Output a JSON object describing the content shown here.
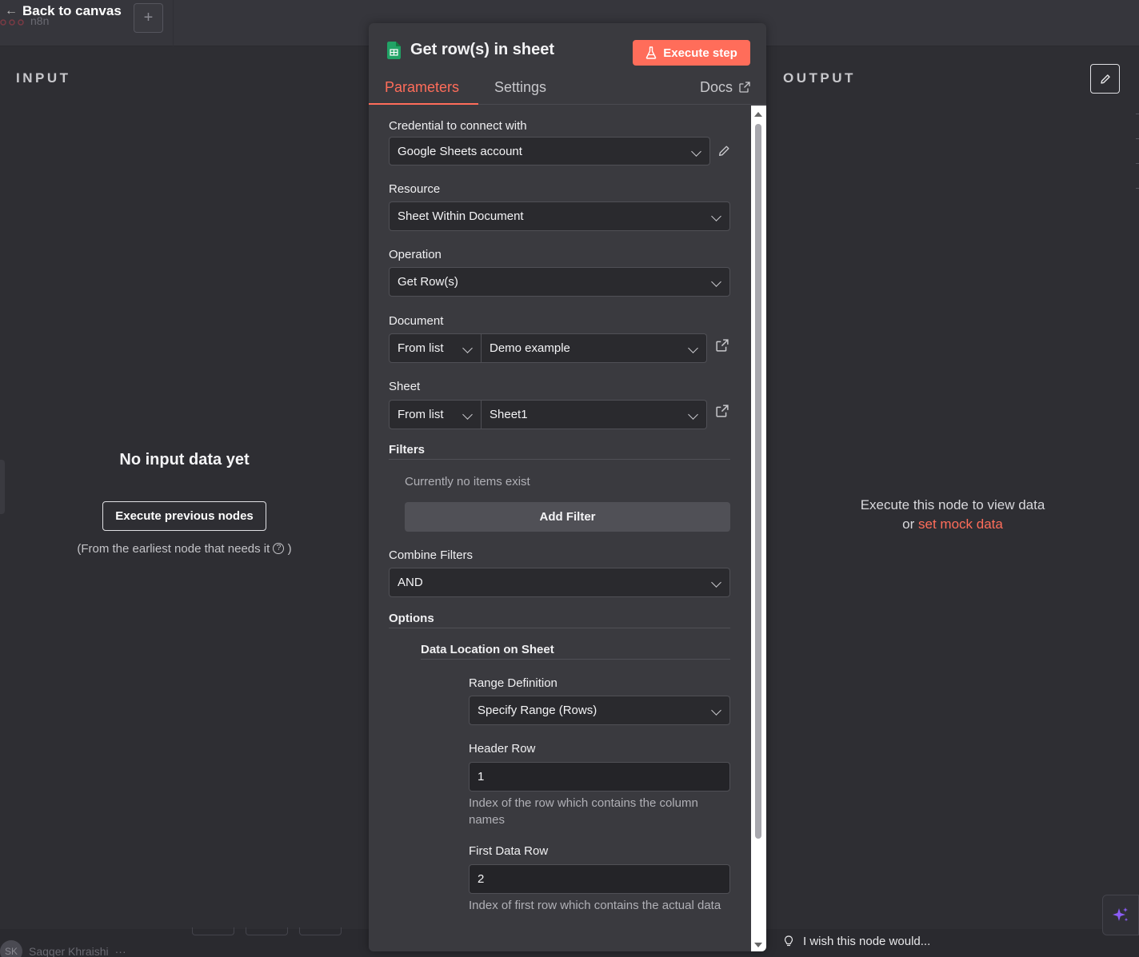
{
  "topbar": {
    "back_label": "Back to canvas",
    "ghost_text": "n8n",
    "plus_label": "+"
  },
  "input_panel": {
    "title": "INPUT",
    "empty_headline": "No input data yet",
    "execute_prev_label": "Execute previous nodes",
    "hint_prefix": "(From the earliest node that needs it",
    "hint_suffix": ")",
    "help_glyph": "?"
  },
  "output_panel": {
    "title": "OUTPUT",
    "empty_line1": "Execute this node to view data",
    "empty_or": "or",
    "mock_link": "set mock data"
  },
  "node": {
    "title": "Get row(s) in sheet",
    "execute_step_label": "Execute step",
    "tabs": {
      "parameters": "Parameters",
      "settings": "Settings",
      "docs": "Docs"
    },
    "fields": {
      "credential_label": "Credential to connect with",
      "credential_value": "Google Sheets account",
      "resource_label": "Resource",
      "resource_value": "Sheet Within Document",
      "operation_label": "Operation",
      "operation_value": "Get Row(s)",
      "document_label": "Document",
      "document_mode": "From list",
      "document_value": "Demo example",
      "sheet_label": "Sheet",
      "sheet_mode": "From list",
      "sheet_value": "Sheet1",
      "filters_label": "Filters",
      "filters_empty": "Currently no items exist",
      "add_filter_label": "Add Filter",
      "combine_label": "Combine Filters",
      "combine_value": "AND",
      "options_label": "Options",
      "data_location_label": "Data Location on Sheet",
      "range_def_label": "Range Definition",
      "range_def_value": "Specify Range (Rows)",
      "header_row_label": "Header Row",
      "header_row_value": "1",
      "header_row_hint": "Index of the row which contains the column names",
      "first_data_row_label": "First Data Row",
      "first_data_row_value": "2",
      "first_data_row_hint": "Index of first row which contains the actual data"
    }
  },
  "footer": {
    "user_initials": "SK",
    "user_name": "Saqqer Khraishi",
    "user_more": "···",
    "wish_text": "I wish this node would..."
  },
  "colors": {
    "accent": "#ff6d5a",
    "panel": "#2e2e33",
    "dialog": "#3a3a3f",
    "input_bg": "#2a2a2e",
    "sheets_green": "#21a366",
    "sparkle": "#8b5cf6"
  },
  "icons": {
    "back": "arrow-left-icon",
    "sheets": "google-sheets-icon",
    "flask": "flask-icon",
    "external": "external-link-icon",
    "pencil": "pencil-icon",
    "chevron": "chevron-down-icon",
    "bulb": "lightbulb-icon",
    "sparkle": "sparkle-icon"
  }
}
